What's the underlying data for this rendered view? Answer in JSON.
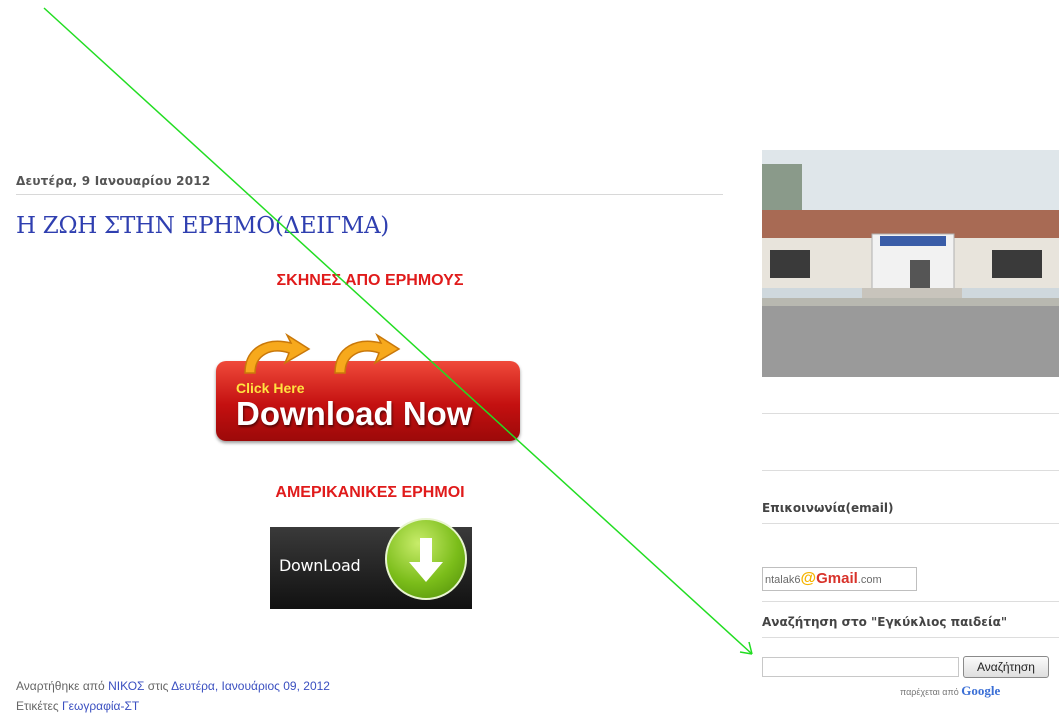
{
  "post": {
    "date": "Δευτέρα, 9 Ιανουαρίου 2012",
    "title": "Η ΖΩΗ ΣΤΗΝ ΕΡΗΜΟ(ΔΕΙΓΜΑ)",
    "heading1": "ΣΚΗΝΕΣ ΑΠΟ ΕΡΗΜΟΥΣ",
    "download_now": {
      "small": "Click Here",
      "big": "Download Now"
    },
    "heading2": "ΑΜΕΡΙΚΑΝΙΚΕΣ ΕΡΗΜΟΙ",
    "download_black": "DownLoad",
    "footer": {
      "posted_by_prefix": "Αναρτήθηκε από",
      "author": "ΝΙΚΟΣ",
      "at_word": "στις",
      "timestamp": "Δευτέρα, Ιανουάριος 09, 2012",
      "labels_prefix": "Ετικέτες",
      "label": "Γεωγραφία-ΣΤ"
    }
  },
  "sidebar": {
    "contact_title": "Επικοινωνία(email)",
    "email": {
      "user": "ntalak6",
      "at": "@",
      "brand": "Gmail",
      "domain": ".com"
    },
    "search_title": "Αναζήτηση στο \"Εγκύκλιος παιδεία\"",
    "search_button": "Αναζήτηση",
    "powered_by": "παρέχεται από",
    "powered_brand": "Google"
  },
  "colors": {
    "title_blue": "#2f3fb0",
    "link_blue": "#3a4fc0",
    "heading_red": "#e01b1b",
    "annotation_green": "#22dd22"
  }
}
